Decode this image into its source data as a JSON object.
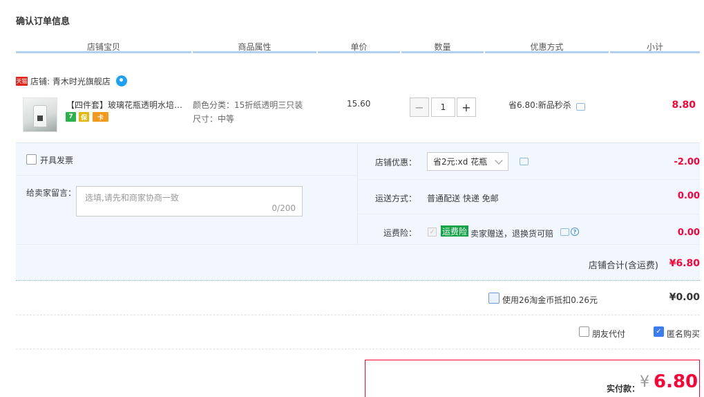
{
  "page": {
    "title": "确认订单信息"
  },
  "columns": [
    "店铺宝贝",
    "商品属性",
    "单价",
    "数量",
    "优惠方式",
    "小计"
  ],
  "shop": {
    "badge": "天猫",
    "label": "店铺: 青木时光旗舰店"
  },
  "item": {
    "title": "【四件套】玻璃花瓶透明水培绿...",
    "icons": [
      "7",
      "保",
      "卡"
    ],
    "attr_color": "颜色分类：15折纸透明三只装",
    "attr_size": "尺寸：中等",
    "price": "15.60",
    "qty_minus": "−",
    "qty_value": "1",
    "qty_plus": "+",
    "promo": "省6.80:新品秒杀",
    "subtotal": "8.80"
  },
  "panel": {
    "invoice_label": "开具发票",
    "message_label": "给卖家留言：",
    "message_placeholder": "选填,请先和商家协商一致",
    "message_count": "0/200",
    "shop_discount_label": "店铺优惠：",
    "shop_discount_select": "省2元:xd 花瓶",
    "shop_discount_value": "-2.00",
    "shipping_label": "运送方式：",
    "shipping_value": "普通配送 快递 免邮",
    "shipping_fee": "0.00",
    "insurance_label": "运费险：",
    "insurance_badge": "运费险",
    "insurance_text": "卖家赠送，退换货可赔",
    "insurance_fee": "0.00",
    "shop_total_label": "店铺合计(含运费)",
    "shop_total_value": "¥6.80"
  },
  "coins": {
    "label": "使用26淘金币抵扣0.26元",
    "value": "¥0.00"
  },
  "options": {
    "friend_pay": "朋友代付",
    "anonymous": "匿名购买"
  },
  "payment": {
    "label": "实付款：",
    "currency": "¥",
    "amount": "6.80"
  },
  "colors": {
    "accent_red": "#ff0036",
    "header_line": "#b2d1f0",
    "panel_bg": "#f2f7ff",
    "badge_green": "#12a347",
    "checkbox_blue": "#3d7cf0"
  }
}
